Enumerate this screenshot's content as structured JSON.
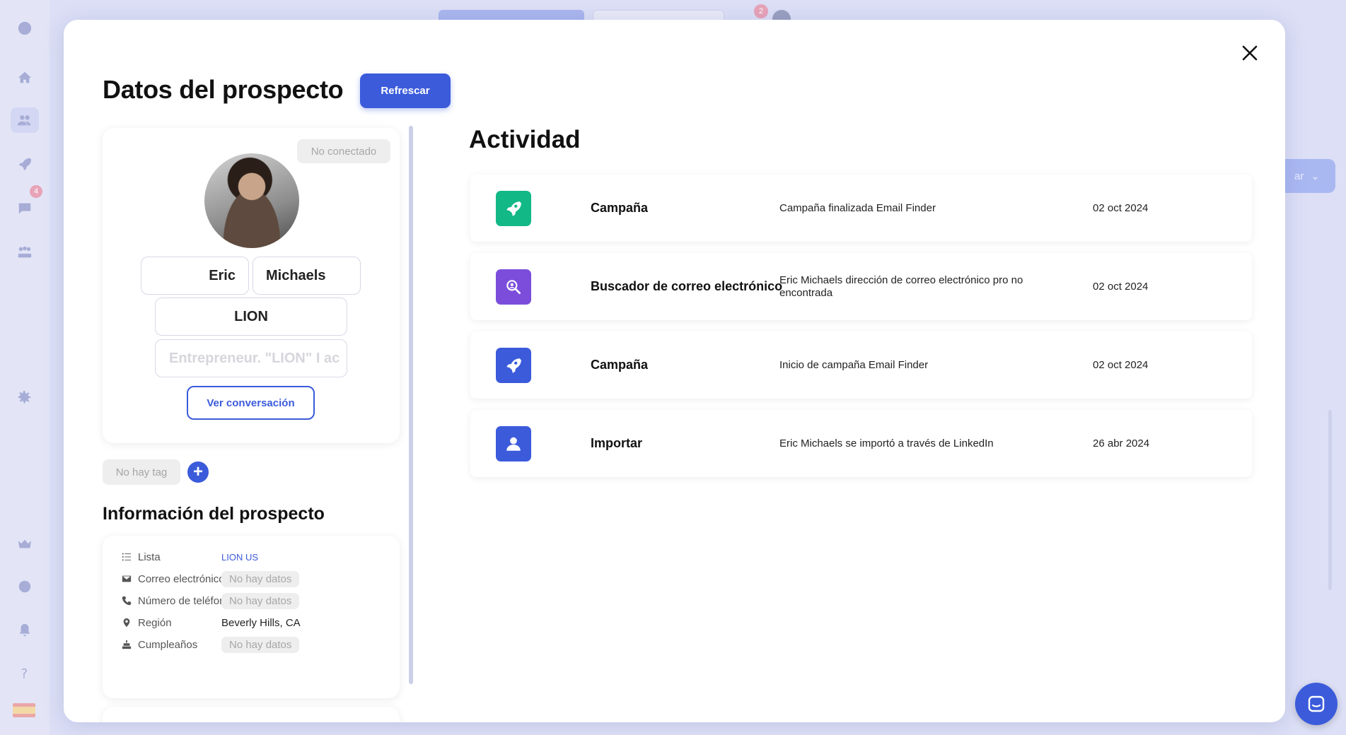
{
  "background": {
    "chat_badge": "4",
    "top_badge": "2",
    "right_button_label": "ar"
  },
  "modal": {
    "title": "Datos del prospecto",
    "refresh_label": "Refrescar",
    "profile": {
      "status": "No conectado",
      "first_name": "Eric",
      "last_name": "Michaels",
      "company": "LION",
      "headline": "Entrepreneur. \"LION\" I ac",
      "conversation_label": "Ver conversación"
    },
    "tags": {
      "empty_label": "No hay tag",
      "add_label": "+"
    },
    "info": {
      "title": "Información del prospecto",
      "rows": [
        {
          "icon": "list-icon",
          "label": "Lista",
          "value": "LION US"
        },
        {
          "icon": "mail-icon",
          "label": "Correo electrónico",
          "value": "No hay datos"
        },
        {
          "icon": "phone-icon",
          "label": "Número de teléfono",
          "value": "No hay datos"
        },
        {
          "icon": "location-pin-icon",
          "label": "Región",
          "value": "Beverly Hills, CA"
        },
        {
          "icon": "cake-icon",
          "label": "Cumpleaños",
          "value": "No hay datos"
        }
      ]
    },
    "activity": {
      "title": "Actividad",
      "items": [
        {
          "icon": "rocket-icon",
          "color": "#12b886",
          "type": "Campaña",
          "description": "Campaña finalizada Email Finder",
          "date": "02 oct 2024"
        },
        {
          "icon": "email-search-icon",
          "color": "#7c4ddb",
          "type": "Buscador de correo electrónico",
          "description": "Eric Michaels dirección de correo electrónico pro no encontrada",
          "date": "02 oct 2024"
        },
        {
          "icon": "rocket-icon",
          "color": "#3b5bdb",
          "type": "Campaña",
          "description": "Inicio de campaña Email Finder",
          "date": "02 oct 2024"
        },
        {
          "icon": "user-icon",
          "color": "#3b5bdb",
          "type": "Importar",
          "description": "Eric Michaels se importó a través de LinkedIn",
          "date": "26 abr 2024"
        }
      ]
    }
  }
}
